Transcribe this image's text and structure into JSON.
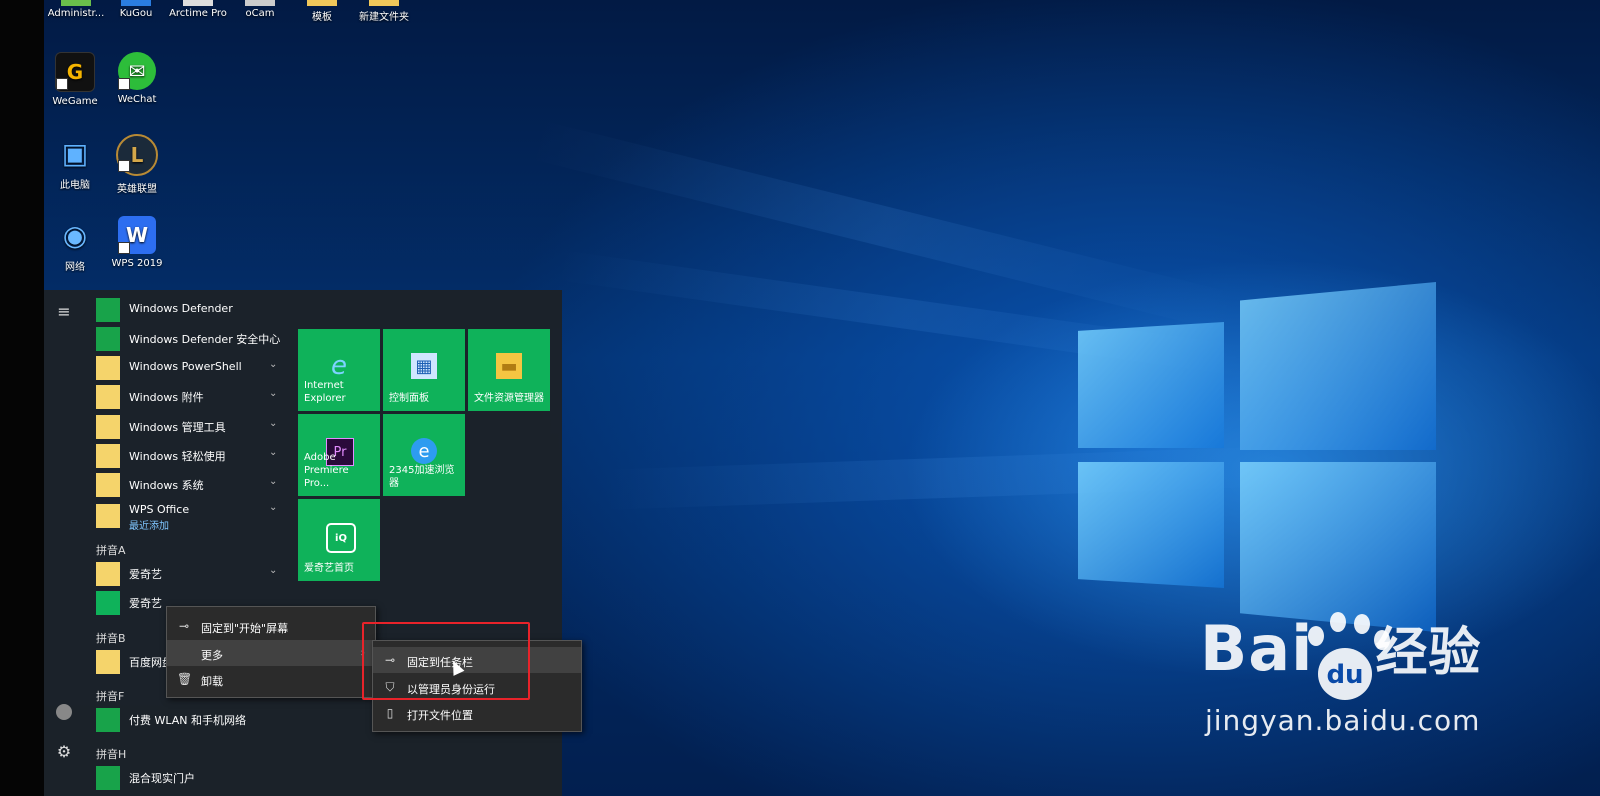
{
  "desktop": {
    "top_row": [
      "Administr...",
      "KuGou",
      "Arctime Pro",
      "oCam",
      "模板",
      "新建文件夹"
    ],
    "icons": [
      {
        "name": "WeGame",
        "glyph": "G",
        "color": "#111111"
      },
      {
        "name": "WeChat",
        "glyph": "✉",
        "color": "#2dbd3a"
      },
      {
        "name": "此电脑",
        "glyph": "▣",
        "color": "#3a8fd8"
      },
      {
        "name": "英雄联盟",
        "glyph": "L",
        "color": "#1b2a3a"
      },
      {
        "name": "网络",
        "glyph": "◉",
        "color": "#2f86d6"
      },
      {
        "name": "WPS 2019",
        "glyph": "W",
        "color": "#2d6ef0"
      }
    ]
  },
  "start_menu": {
    "apps": [
      {
        "name": "Windows Defender",
        "icon": "shield-icon"
      },
      {
        "name": "Windows Defender 安全中心",
        "icon": "shield-icon"
      },
      {
        "name": "Windows PowerShell",
        "icon": "folder-icon"
      },
      {
        "name": "Windows 附件",
        "icon": "folder-icon"
      },
      {
        "name": "Windows 管理工具",
        "icon": "folder-icon"
      },
      {
        "name": "Windows 轻松使用",
        "icon": "folder-icon"
      },
      {
        "name": "Windows 系统",
        "icon": "folder-icon"
      },
      {
        "name": "WPS Office",
        "sub": "最近添加",
        "icon": "folder-icon"
      }
    ],
    "group_a": "拼音A",
    "group_a_apps": [
      "爱奇艺",
      "爱奇艺"
    ],
    "group_b": "拼音B",
    "group_b_apps": [
      "百度网盘"
    ],
    "group_f": "拼音F",
    "group_f_apps": [
      "付费 WLAN 和手机网络"
    ],
    "group_h": "拼音H",
    "group_h_apps": [
      "混合现实门户"
    ],
    "tiles": [
      {
        "label": "Internet Explorer",
        "icon": "ie-icon"
      },
      {
        "label": "控制面板",
        "icon": "control-panel-icon"
      },
      {
        "label": "文件资源管理器",
        "icon": "file-explorer-icon"
      },
      {
        "label": "Adobe Premiere Pro...",
        "icon": "premiere-icon"
      },
      {
        "label": "2345加速浏览器",
        "icon": "browser-icon"
      },
      {
        "label": "爱奇艺首页",
        "icon": "iqiyi-icon"
      }
    ]
  },
  "context_menu": {
    "pin_start": "固定到\"开始\"屏幕",
    "more": "更多",
    "uninstall": "卸载"
  },
  "submenu": {
    "pin_taskbar": "固定到任务栏",
    "run_admin": "以管理员身份运行",
    "open_location": "打开文件位置"
  },
  "watermark": {
    "logo": "Bai",
    "logo_du": "du",
    "logo_suffix": "经验",
    "url": "jingyan.baidu.com"
  },
  "colors": {
    "tile": "#0fb25a",
    "accent": "#e8232a",
    "menu_bg": "#1c2228"
  }
}
